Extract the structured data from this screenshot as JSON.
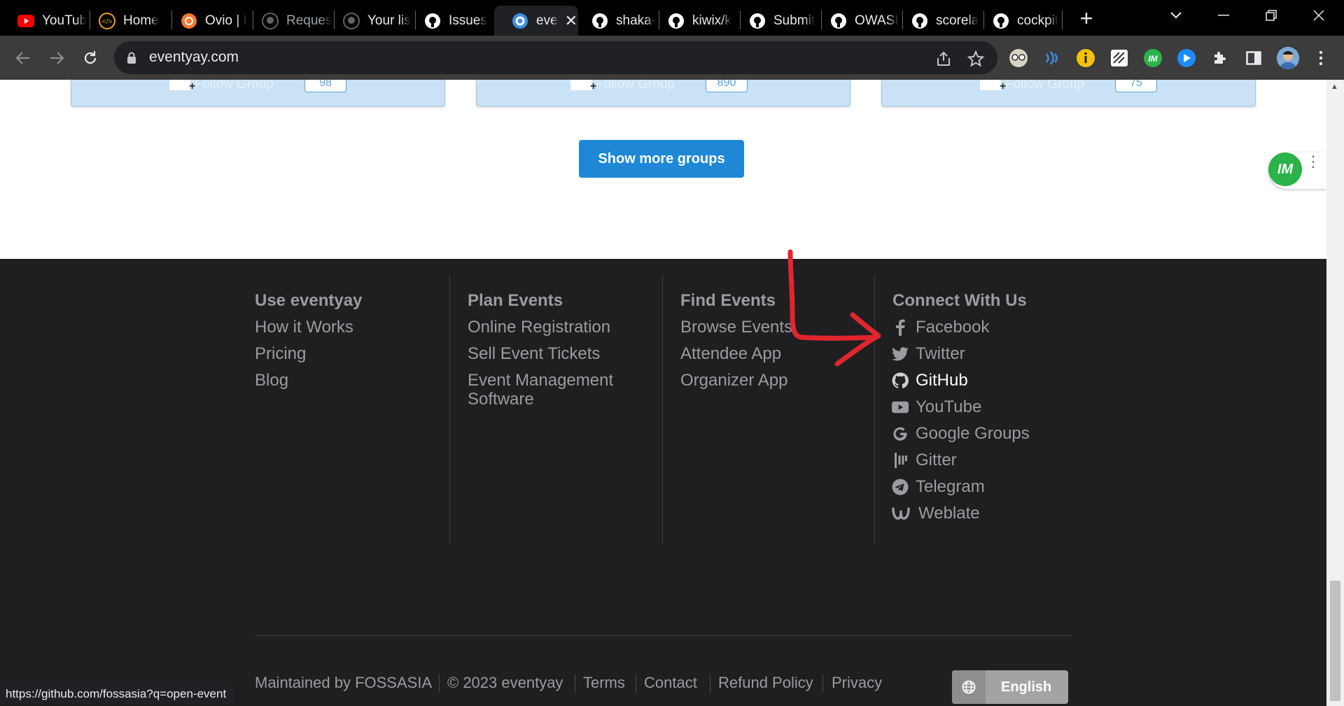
{
  "browser": {
    "tabs": [
      {
        "label": "YouTub",
        "icon": "youtube-icon"
      },
      {
        "label": "Home",
        "icon": "code-icon"
      },
      {
        "label": "Ovio | I",
        "icon": "ovio-icon"
      },
      {
        "label": "Reques",
        "icon": "github-icon"
      },
      {
        "label": "Your lis",
        "icon": "github-icon"
      },
      {
        "label": "Issues",
        "icon": "github-icon"
      },
      {
        "label": "eve",
        "icon": "eventyay-icon",
        "active": true
      },
      {
        "label": "shaka-",
        "icon": "github-icon"
      },
      {
        "label": "kiwix/k",
        "icon": "github-icon"
      },
      {
        "label": "Submit",
        "icon": "github-icon"
      },
      {
        "label": "OWASI",
        "icon": "github-icon"
      },
      {
        "label": "scorela",
        "icon": "github-icon"
      },
      {
        "label": "cockpit",
        "icon": "github-icon"
      }
    ],
    "url": "eventyay.com",
    "status_url": "https://github.com/fossasia?q=open-event"
  },
  "groups": {
    "cards": [
      {
        "follow_label": "Follow Group",
        "count": "98"
      },
      {
        "follow_label": "Follow Group",
        "count": "890"
      },
      {
        "follow_label": "Follow Group",
        "count": "75"
      }
    ],
    "show_more_label": "Show more groups"
  },
  "widget": {
    "logo_text": "IM"
  },
  "footer": {
    "columns": [
      {
        "heading": "Use eventyay",
        "links": [
          "How it Works",
          "Pricing",
          "Blog"
        ]
      },
      {
        "heading": "Plan Events",
        "links": [
          "Online Registration",
          "Sell Event Tickets",
          "Event Management",
          "Software"
        ]
      },
      {
        "heading": "Find Events",
        "links": [
          "Browse Events",
          "Attendee App",
          "Organizer App"
        ]
      }
    ],
    "connect": {
      "heading": "Connect With Us",
      "links": [
        {
          "label": "Facebook",
          "icon": "facebook-icon"
        },
        {
          "label": "Twitter",
          "icon": "twitter-icon"
        },
        {
          "label": "GitHub",
          "icon": "github-icon",
          "hovered": true
        },
        {
          "label": "YouTube",
          "icon": "youtube-icon"
        },
        {
          "label": "Google Groups",
          "icon": "google-icon"
        },
        {
          "label": "Gitter",
          "icon": "gitter-icon"
        },
        {
          "label": "Telegram",
          "icon": "telegram-icon"
        },
        {
          "label": "Weblate",
          "icon": "weblate-icon"
        }
      ]
    },
    "bottom": {
      "maintained": "Maintained by FOSSASIA",
      "copyright": "© 2023 eventyay",
      "terms": "Terms",
      "contact": "Contact",
      "refund": "Refund Policy",
      "privacy": "Privacy"
    },
    "language": "English"
  },
  "colors": {
    "footer_bg": "#1f1f21",
    "footer_text": "#9b9ba0",
    "primary_button": "#1e88d6",
    "annotation_arrow": "#e0262c"
  }
}
